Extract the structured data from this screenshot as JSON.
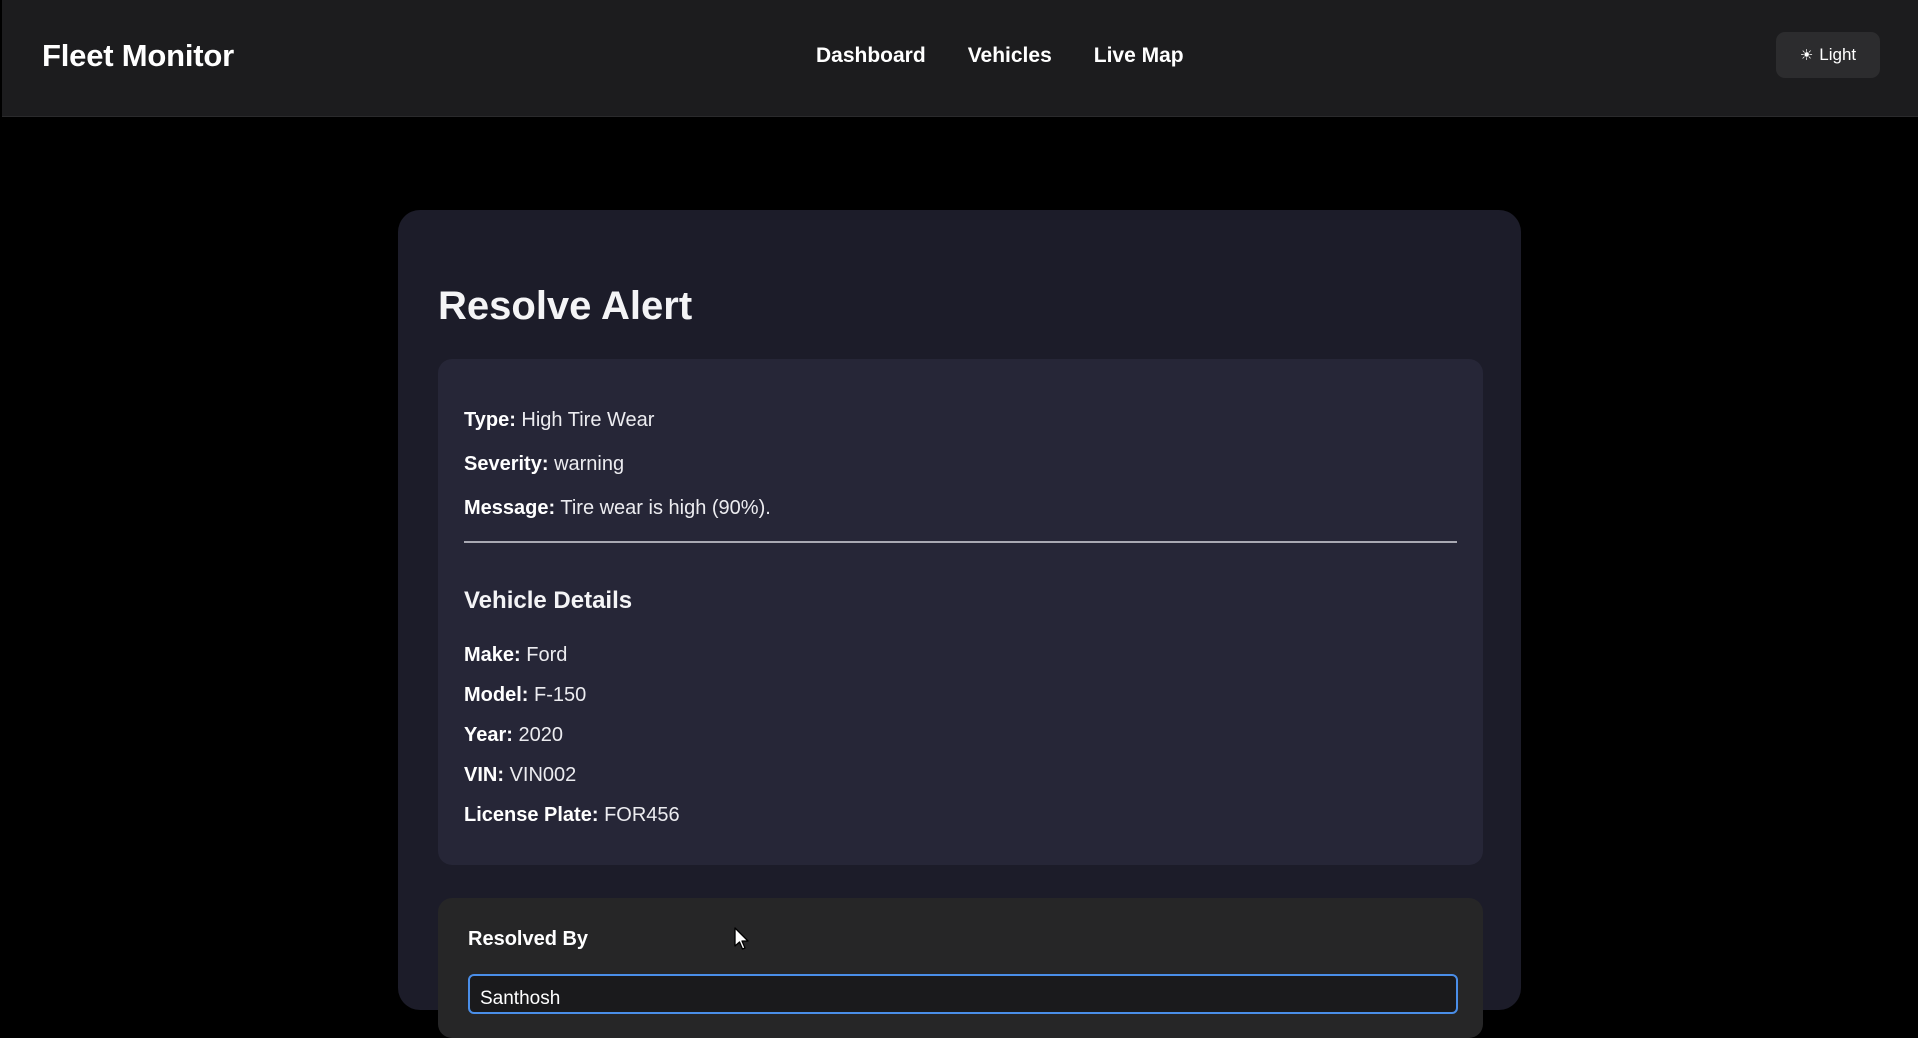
{
  "header": {
    "brand": "Fleet Monitor",
    "nav": [
      "Dashboard",
      "Vehicles",
      "Live Map"
    ],
    "theme_toggle": {
      "icon": "sun-icon",
      "glyph": "☀",
      "label": "Light"
    }
  },
  "alert_card": {
    "title": "Resolve Alert",
    "alert": {
      "type_label": "Type:",
      "type_value": "High Tire Wear",
      "severity_label": "Severity:",
      "severity_value": "warning",
      "message_label": "Message:",
      "message_value": "Tire wear is high (90%)."
    },
    "vehicle": {
      "section_title": "Vehicle Details",
      "make_label": "Make:",
      "make_value": "Ford",
      "model_label": "Model:",
      "model_value": "F-150",
      "year_label": "Year:",
      "year_value": "2020",
      "vin_label": "VIN:",
      "vin_value": "VIN002",
      "plate_label": "License Plate:",
      "plate_value": "FOR456"
    },
    "form": {
      "resolved_by_label": "Resolved By",
      "resolved_by_value": "Santhosh"
    }
  },
  "colors": {
    "page_bg": "#000000",
    "navbar_bg": "#1c1c1e",
    "card_bg": "#1c1c29",
    "panel_bg": "#262637",
    "input_focus_border": "#4a8ee8"
  }
}
